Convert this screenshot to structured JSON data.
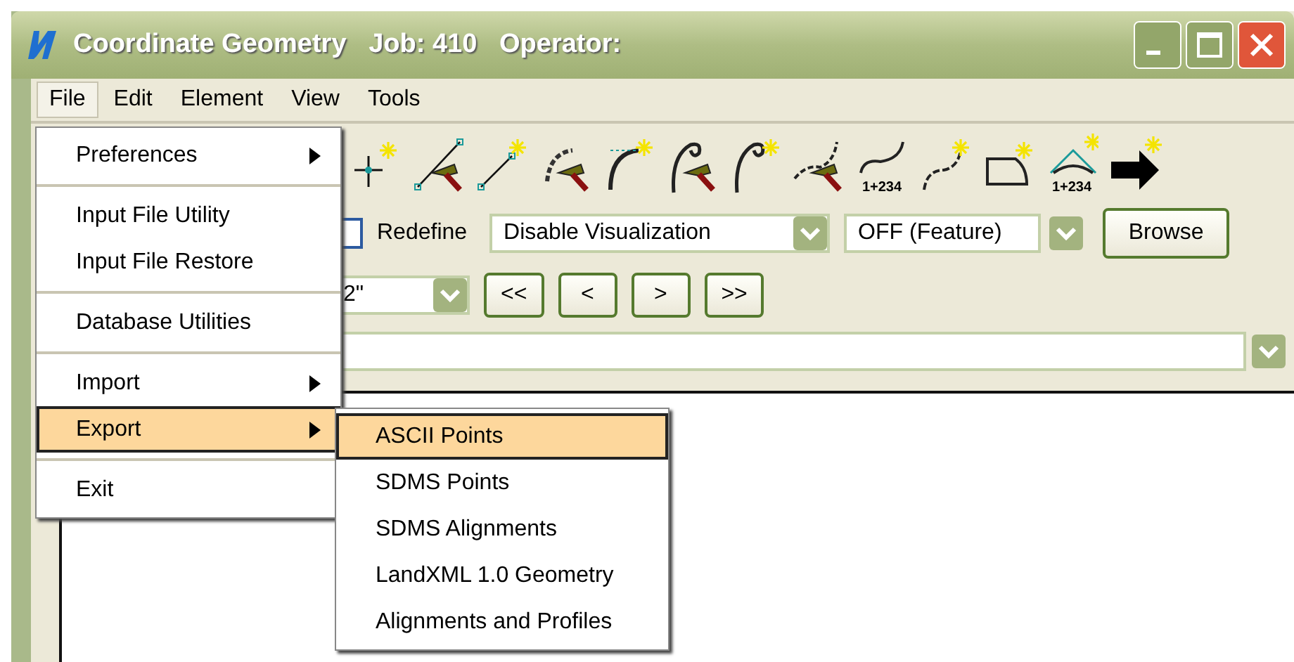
{
  "window": {
    "title": "Coordinate Geometry   Job: 410   Operator:"
  },
  "menu_bar": [
    {
      "label": "File",
      "selected": true
    },
    {
      "label": "Edit",
      "selected": false
    },
    {
      "label": "Element",
      "selected": false
    },
    {
      "label": "View",
      "selected": false
    },
    {
      "label": "Tools",
      "selected": false
    }
  ],
  "file_menu": [
    {
      "kind": "item",
      "label": "Preferences",
      "submenu": true,
      "selected": false
    },
    {
      "kind": "separator"
    },
    {
      "kind": "item",
      "label": "Input File Utility",
      "submenu": false,
      "selected": false
    },
    {
      "kind": "item",
      "label": "Input File Restore",
      "submenu": false,
      "selected": false
    },
    {
      "kind": "separator"
    },
    {
      "kind": "item",
      "label": "Database Utilities",
      "submenu": false,
      "selected": false
    },
    {
      "kind": "separator"
    },
    {
      "kind": "item",
      "label": "Import",
      "submenu": true,
      "selected": false
    },
    {
      "kind": "item",
      "label": "Export",
      "submenu": true,
      "selected": true
    },
    {
      "kind": "separator"
    },
    {
      "kind": "item",
      "label": "Exit",
      "submenu": false,
      "selected": false
    }
  ],
  "export_submenu": [
    {
      "label": "ASCII Points",
      "selected": true
    },
    {
      "label": "SDMS Points",
      "selected": false
    },
    {
      "label": "SDMS Alignments",
      "selected": false
    },
    {
      "label": "LandXML 1.0 Geometry",
      "selected": false
    },
    {
      "label": "Alignments and Profiles",
      "selected": false
    }
  ],
  "toolbar": [
    {
      "kind": "point-star"
    },
    {
      "kind": "line-hammer"
    },
    {
      "kind": "line-star"
    },
    {
      "kind": "arc-hammer"
    },
    {
      "kind": "arc-star"
    },
    {
      "kind": "spiral-hammer"
    },
    {
      "kind": "spiral-star"
    },
    {
      "kind": "curve-hammer"
    },
    {
      "kind": "curve-station",
      "label": "1+234"
    },
    {
      "kind": "curve-star"
    },
    {
      "kind": "shape-star"
    },
    {
      "kind": "triangle-station",
      "label": "1+234"
    },
    {
      "kind": "arrow"
    }
  ],
  "redefine": {
    "label": "Redefine",
    "checked": false
  },
  "visualization_dropdown": {
    "value": "Disable Visualization"
  },
  "feature_dropdown": {
    "value": "OFF (Feature)"
  },
  "browse_button": {
    "label": "Browse"
  },
  "element_dropdown": {
    "value": "2\""
  },
  "nav_buttons": [
    "<<",
    "<",
    ">",
    ">>"
  ]
}
